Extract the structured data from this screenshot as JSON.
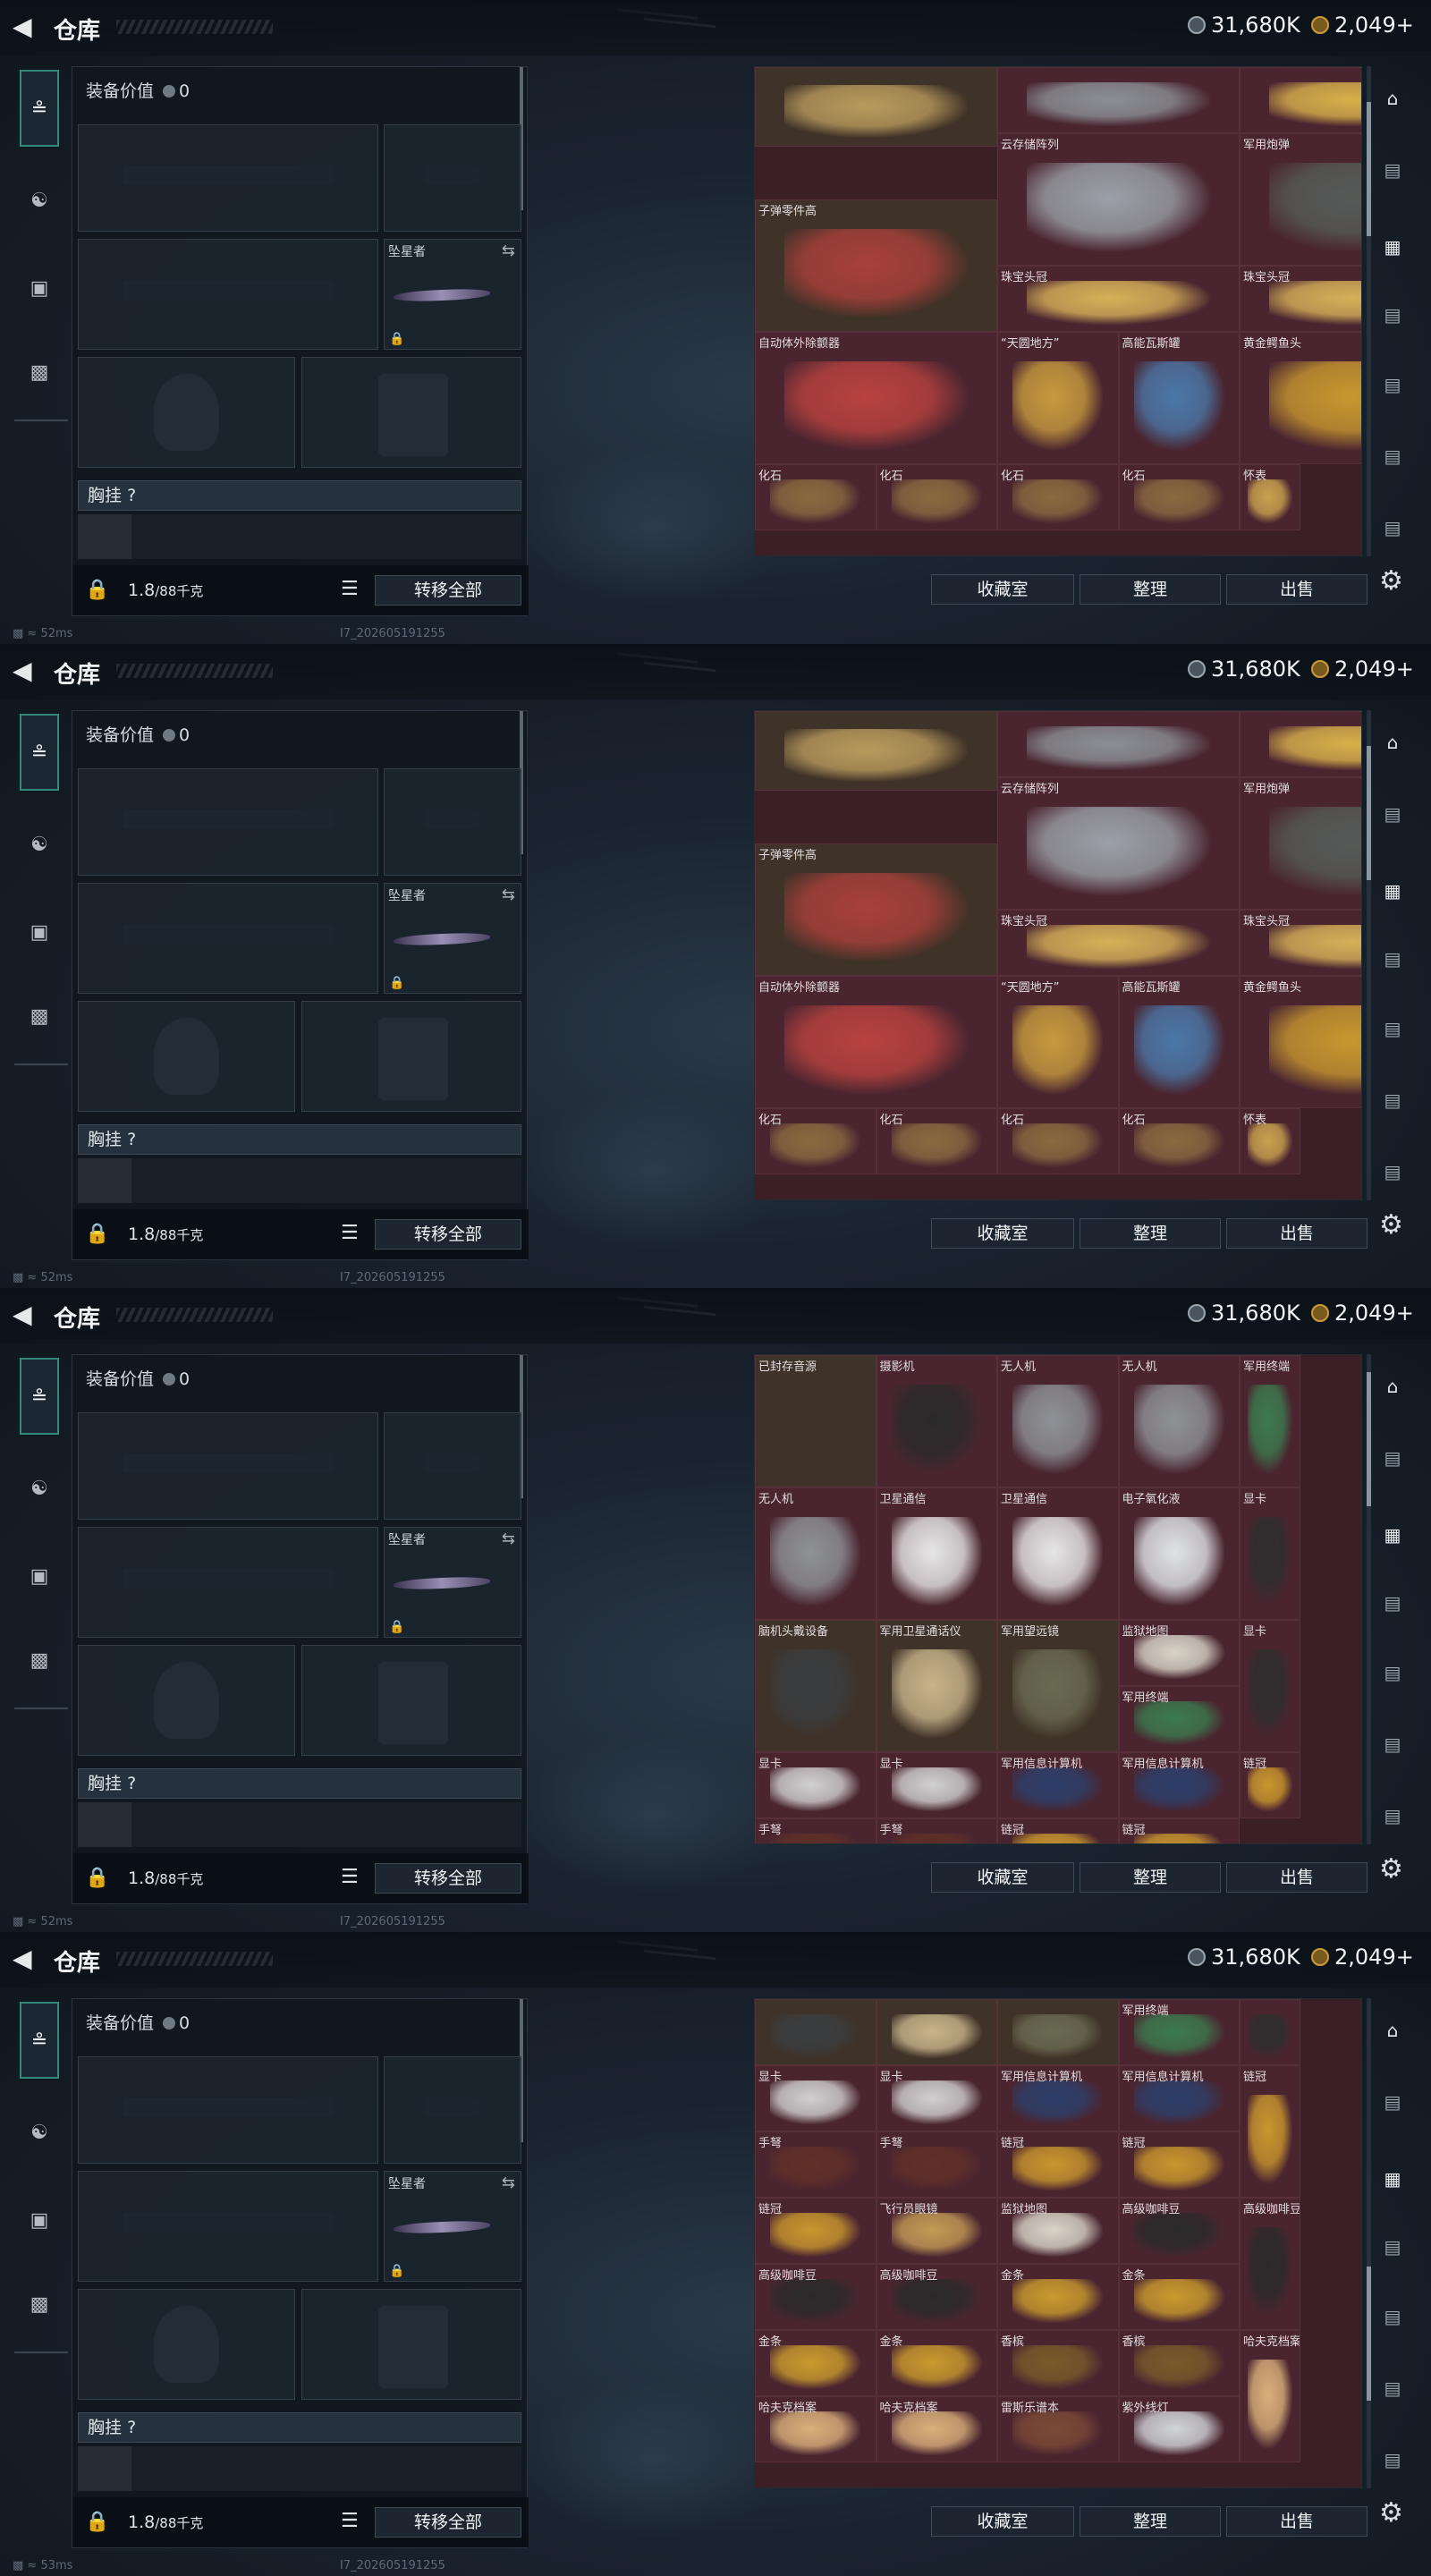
{
  "header": {
    "back_label": "<",
    "title": "仓库",
    "currency_silver": "31,680K",
    "currency_gold": "2,049+"
  },
  "left_panel": {
    "equip_value_label": "装备价值",
    "equip_value": "0",
    "melee_name": "坠星者",
    "chest_rig_label": "胸挂",
    "chest_rig_hint": "?",
    "weight": "1.8",
    "weight_max": "/88千克",
    "transfer_all": "转移全部"
  },
  "tabs": [
    {
      "icon": "gun-icon"
    },
    {
      "icon": "helmet-icon"
    },
    {
      "icon": "backpack-icon"
    },
    {
      "icon": "case-icon"
    }
  ],
  "actions": {
    "collection": "收藏室",
    "sort": "整理",
    "sell": "出售"
  },
  "status": {
    "ping": "52ms",
    "ping_last": "53ms",
    "version": "I7_202605191255"
  },
  "frames": [
    {
      "offset": 0,
      "cells": [
        {
          "n": "",
          "c": 0,
          "r": 0,
          "w": 2,
          "h": 1.2,
          "t": "#b89a5c",
          "bg": "brown"
        },
        {
          "n": "",
          "c": 2,
          "r": 0,
          "w": 2,
          "h": 1,
          "t": "#8a8f94"
        },
        {
          "n": "",
          "c": 4,
          "r": 0,
          "w": 2,
          "h": 1,
          "t": "#d9b04b"
        },
        {
          "n": "云存储阵列",
          "c": 2,
          "r": 1,
          "w": 2,
          "h": 2,
          "t": "#9aa0a6"
        },
        {
          "n": "军用炮弹",
          "c": 4,
          "r": 1,
          "w": 2,
          "h": 2,
          "t": "#555b58"
        },
        {
          "n": "子弹零件高",
          "c": 0,
          "r": 2,
          "w": 2,
          "h": 2,
          "t": "#a8403a",
          "bg": "brown"
        },
        {
          "n": "珠宝头冠",
          "c": 2,
          "r": 3,
          "w": 2,
          "h": 1,
          "t": "#d6b158"
        },
        {
          "n": "珠宝头冠",
          "c": 4,
          "r": 3,
          "w": 2,
          "h": 1,
          "t": "#d6b158"
        },
        {
          "n": "自动体外除颤器",
          "c": 0,
          "r": 4,
          "w": 2,
          "h": 2,
          "t": "#b8423e"
        },
        {
          "n": "“天圆地方”",
          "c": 2,
          "r": 4,
          "w": 1,
          "h": 2,
          "t": "#c79a3e"
        },
        {
          "n": "高能瓦斯罐",
          "c": 3,
          "r": 4,
          "w": 1,
          "h": 2,
          "t": "#4b77a8"
        },
        {
          "n": "黄金鳄鱼头",
          "c": 4,
          "r": 4,
          "w": 2,
          "h": 2,
          "t": "#c8982f"
        },
        {
          "n": "化石",
          "c": 0,
          "r": 6,
          "w": 1,
          "h": 1,
          "t": "#8b6a40"
        },
        {
          "n": "化石",
          "c": 1,
          "r": 6,
          "w": 1,
          "h": 1,
          "t": "#8b6a40"
        },
        {
          "n": "化石",
          "c": 2,
          "r": 6,
          "w": 1,
          "h": 1,
          "t": "#8b6a40"
        },
        {
          "n": "化石",
          "c": 3,
          "r": 6,
          "w": 1,
          "h": 1,
          "t": "#8b6a40"
        },
        {
          "n": "怀表",
          "c": 4,
          "r": 6,
          "w": 0.5,
          "h": 1,
          "t": "#c9a24f"
        }
      ]
    },
    {
      "offset": 0,
      "cells": [
        {
          "n": "",
          "c": 0,
          "r": 0,
          "w": 2,
          "h": 1.2,
          "t": "#b89a5c",
          "bg": "brown"
        },
        {
          "n": "",
          "c": 2,
          "r": 0,
          "w": 2,
          "h": 1,
          "t": "#8a8f94"
        },
        {
          "n": "",
          "c": 4,
          "r": 0,
          "w": 2,
          "h": 1,
          "t": "#d9b04b"
        },
        {
          "n": "云存储阵列",
          "c": 2,
          "r": 1,
          "w": 2,
          "h": 2,
          "t": "#9aa0a6"
        },
        {
          "n": "军用炮弹",
          "c": 4,
          "r": 1,
          "w": 2,
          "h": 2,
          "t": "#555b58"
        },
        {
          "n": "子弹零件高",
          "c": 0,
          "r": 2,
          "w": 2,
          "h": 2,
          "t": "#a8403a",
          "bg": "brown"
        },
        {
          "n": "珠宝头冠",
          "c": 2,
          "r": 3,
          "w": 2,
          "h": 1,
          "t": "#d6b158"
        },
        {
          "n": "珠宝头冠",
          "c": 4,
          "r": 3,
          "w": 2,
          "h": 1,
          "t": "#d6b158"
        },
        {
          "n": "自动体外除颤器",
          "c": 0,
          "r": 4,
          "w": 2,
          "h": 2,
          "t": "#b8423e"
        },
        {
          "n": "“天圆地方”",
          "c": 2,
          "r": 4,
          "w": 1,
          "h": 2,
          "t": "#c79a3e"
        },
        {
          "n": "高能瓦斯罐",
          "c": 3,
          "r": 4,
          "w": 1,
          "h": 2,
          "t": "#4b77a8"
        },
        {
          "n": "黄金鳄鱼头",
          "c": 4,
          "r": 4,
          "w": 2,
          "h": 2,
          "t": "#c8982f"
        },
        {
          "n": "化石",
          "c": 0,
          "r": 6,
          "w": 1,
          "h": 1,
          "t": "#8b6a40"
        },
        {
          "n": "化石",
          "c": 1,
          "r": 6,
          "w": 1,
          "h": 1,
          "t": "#8b6a40"
        },
        {
          "n": "化石",
          "c": 2,
          "r": 6,
          "w": 1,
          "h": 1,
          "t": "#8b6a40"
        },
        {
          "n": "化石",
          "c": 3,
          "r": 6,
          "w": 1,
          "h": 1,
          "t": "#8b6a40"
        },
        {
          "n": "怀表",
          "c": 4,
          "r": 6,
          "w": 0.5,
          "h": 1,
          "t": "#c9a24f"
        }
      ]
    },
    {
      "offset": 0,
      "cells": [
        {
          "n": "已封存音源",
          "c": 0,
          "r": 0,
          "w": 1,
          "h": 2,
          "t": "#555",
          "bg": "brown"
        },
        {
          "n": "摄影机",
          "c": 1,
          "r": 0,
          "w": 1,
          "h": 2,
          "t": "#2a2a2a"
        },
        {
          "n": "无人机",
          "c": 2,
          "r": 0,
          "w": 1,
          "h": 2,
          "t": "#8e9296"
        },
        {
          "n": "无人机",
          "c": 3,
          "r": 0,
          "w": 1,
          "h": 2,
          "t": "#8e9296"
        },
        {
          "n": "军用终端",
          "c": 4,
          "r": 0,
          "w": 0.5,
          "h": 2,
          "t": "#3c7a4e"
        },
        {
          "n": "无人机",
          "c": 0,
          "r": 2,
          "w": 1,
          "h": 2,
          "t": "#8e9296"
        },
        {
          "n": "卫星通信",
          "c": 1,
          "r": 2,
          "w": 1,
          "h": 2,
          "t": "#e6e6e6"
        },
        {
          "n": "卫星通信",
          "c": 2,
          "r": 2,
          "w": 1,
          "h": 2,
          "t": "#e6e6e6"
        },
        {
          "n": "电子氧化液",
          "c": 3,
          "r": 2,
          "w": 1,
          "h": 2,
          "t": "#dfe3e6"
        },
        {
          "n": "显卡",
          "c": 4,
          "r": 2,
          "w": 0.5,
          "h": 2,
          "t": "#2e2e2e"
        },
        {
          "n": "脑机头戴设备",
          "c": 0,
          "r": 4,
          "w": 1,
          "h": 2,
          "t": "#3a3d40",
          "bg": "brown"
        },
        {
          "n": "军用卫星通话仪",
          "c": 1,
          "r": 4,
          "w": 1,
          "h": 2,
          "t": "#c8b48a",
          "bg": "brown"
        },
        {
          "n": "军用望远镜",
          "c": 2,
          "r": 4,
          "w": 1,
          "h": 2,
          "t": "#6a6a52",
          "bg": "brown"
        },
        {
          "n": "监狱地图",
          "c": 3,
          "r": 4,
          "w": 1,
          "h": 1,
          "t": "#d8d4c8"
        },
        {
          "n": "显卡",
          "c": 4,
          "r": 4,
          "w": 0.5,
          "h": 2,
          "t": "#2e2e2e"
        },
        {
          "n": "军用终端",
          "c": 3,
          "r": 5,
          "w": 1,
          "h": 1,
          "t": "#3c7a4e"
        },
        {
          "n": "显卡",
          "c": 0,
          "r": 6,
          "w": 1,
          "h": 1,
          "t": "#d0d0d0"
        },
        {
          "n": "显卡",
          "c": 1,
          "r": 6,
          "w": 1,
          "h": 1,
          "t": "#d0d0d0"
        },
        {
          "n": "军用信息计算机",
          "c": 2,
          "r": 6,
          "w": 1,
          "h": 1,
          "t": "#2d3f6a"
        },
        {
          "n": "军用信息计算机",
          "c": 3,
          "r": 6,
          "w": 1,
          "h": 1,
          "t": "#2d3f6a"
        },
        {
          "n": "链冠",
          "c": 4,
          "r": 6,
          "w": 0.5,
          "h": 1,
          "t": "#c9962e"
        },
        {
          "n": "手弩",
          "c": 0,
          "r": 7,
          "w": 1,
          "h": 1,
          "t": "#603028"
        },
        {
          "n": "手弩",
          "c": 1,
          "r": 7,
          "w": 1,
          "h": 1,
          "t": "#603028"
        },
        {
          "n": "链冠",
          "c": 2,
          "r": 7,
          "w": 1,
          "h": 1,
          "t": "#c9962e"
        },
        {
          "n": "链冠",
          "c": 3,
          "r": 7,
          "w": 1,
          "h": 1,
          "t": "#c9962e"
        }
      ]
    },
    {
      "offset": 0,
      "cells": [
        {
          "n": "",
          "c": 0,
          "r": 0,
          "w": 1,
          "h": 1,
          "t": "#3a3d40",
          "bg": "brown"
        },
        {
          "n": "",
          "c": 1,
          "r": 0,
          "w": 1,
          "h": 1,
          "t": "#c8b48a",
          "bg": "brown"
        },
        {
          "n": "",
          "c": 2,
          "r": 0,
          "w": 1,
          "h": 1,
          "t": "#6a6a52",
          "bg": "brown"
        },
        {
          "n": "军用终端",
          "c": 3,
          "r": 0,
          "w": 1,
          "h": 1,
          "t": "#3c7a4e"
        },
        {
          "n": "",
          "c": 4,
          "r": 0,
          "w": 0.5,
          "h": 1,
          "t": "#2e2e2e"
        },
        {
          "n": "显卡",
          "c": 0,
          "r": 1,
          "w": 1,
          "h": 1,
          "t": "#d0d0d0"
        },
        {
          "n": "显卡",
          "c": 1,
          "r": 1,
          "w": 1,
          "h": 1,
          "t": "#d0d0d0"
        },
        {
          "n": "军用信息计算机",
          "c": 2,
          "r": 1,
          "w": 1,
          "h": 1,
          "t": "#2d3f6a"
        },
        {
          "n": "军用信息计算机",
          "c": 3,
          "r": 1,
          "w": 1,
          "h": 1,
          "t": "#2d3f6a"
        },
        {
          "n": "链冠",
          "c": 4,
          "r": 1,
          "w": 0.5,
          "h": 2,
          "t": "#c9962e"
        },
        {
          "n": "手弩",
          "c": 0,
          "r": 2,
          "w": 1,
          "h": 1,
          "t": "#603028"
        },
        {
          "n": "手弩",
          "c": 1,
          "r": 2,
          "w": 1,
          "h": 1,
          "t": "#603028"
        },
        {
          "n": "链冠",
          "c": 2,
          "r": 2,
          "w": 1,
          "h": 1,
          "t": "#c9962e"
        },
        {
          "n": "链冠",
          "c": 3,
          "r": 2,
          "w": 1,
          "h": 1,
          "t": "#c9962e"
        },
        {
          "n": "链冠",
          "c": 0,
          "r": 3,
          "w": 1,
          "h": 1,
          "t": "#c9962e"
        },
        {
          "n": "飞行员眼镜",
          "c": 1,
          "r": 3,
          "w": 1,
          "h": 1,
          "t": "#c29a55"
        },
        {
          "n": "监狱地图",
          "c": 2,
          "r": 3,
          "w": 1,
          "h": 1,
          "t": "#d8d4c8"
        },
        {
          "n": "高级咖啡豆",
          "c": 3,
          "r": 3,
          "w": 1,
          "h": 1,
          "t": "#2a2a2a"
        },
        {
          "n": "高级咖啡豆",
          "c": 4,
          "r": 3,
          "w": 0.5,
          "h": 2,
          "t": "#2a2a2a"
        },
        {
          "n": "高级咖啡豆",
          "c": 0,
          "r": 4,
          "w": 1,
          "h": 1,
          "t": "#2a2a2a"
        },
        {
          "n": "高级咖啡豆",
          "c": 1,
          "r": 4,
          "w": 1,
          "h": 1,
          "t": "#2a2a2a"
        },
        {
          "n": "金条",
          "c": 2,
          "r": 4,
          "w": 1,
          "h": 1,
          "t": "#c99a2e"
        },
        {
          "n": "金条",
          "c": 3,
          "r": 4,
          "w": 1,
          "h": 1,
          "t": "#c99a2e"
        },
        {
          "n": "金条",
          "c": 0,
          "r": 5,
          "w": 1,
          "h": 1,
          "t": "#c99a2e"
        },
        {
          "n": "金条",
          "c": 1,
          "r": 5,
          "w": 1,
          "h": 1,
          "t": "#c99a2e"
        },
        {
          "n": "香槟",
          "c": 2,
          "r": 5,
          "w": 1,
          "h": 1,
          "t": "#7a5a2a"
        },
        {
          "n": "香槟",
          "c": 3,
          "r": 5,
          "w": 1,
          "h": 1,
          "t": "#7a5a2a"
        },
        {
          "n": "哈夫克档案",
          "c": 4,
          "r": 5,
          "w": 0.5,
          "h": 2,
          "t": "#d9b07a"
        },
        {
          "n": "哈夫克档案",
          "c": 0,
          "r": 6,
          "w": 1,
          "h": 1,
          "t": "#d9b07a"
        },
        {
          "n": "哈夫克档案",
          "c": 1,
          "r": 6,
          "w": 1,
          "h": 1,
          "t": "#d9b07a"
        },
        {
          "n": "雷斯乐谱本",
          "c": 2,
          "r": 6,
          "w": 1,
          "h": 1,
          "t": "#7a4a36"
        },
        {
          "n": "紫外线灯",
          "c": 3,
          "r": 6,
          "w": 1,
          "h": 1,
          "t": "#d0d4d8"
        }
      ]
    }
  ]
}
